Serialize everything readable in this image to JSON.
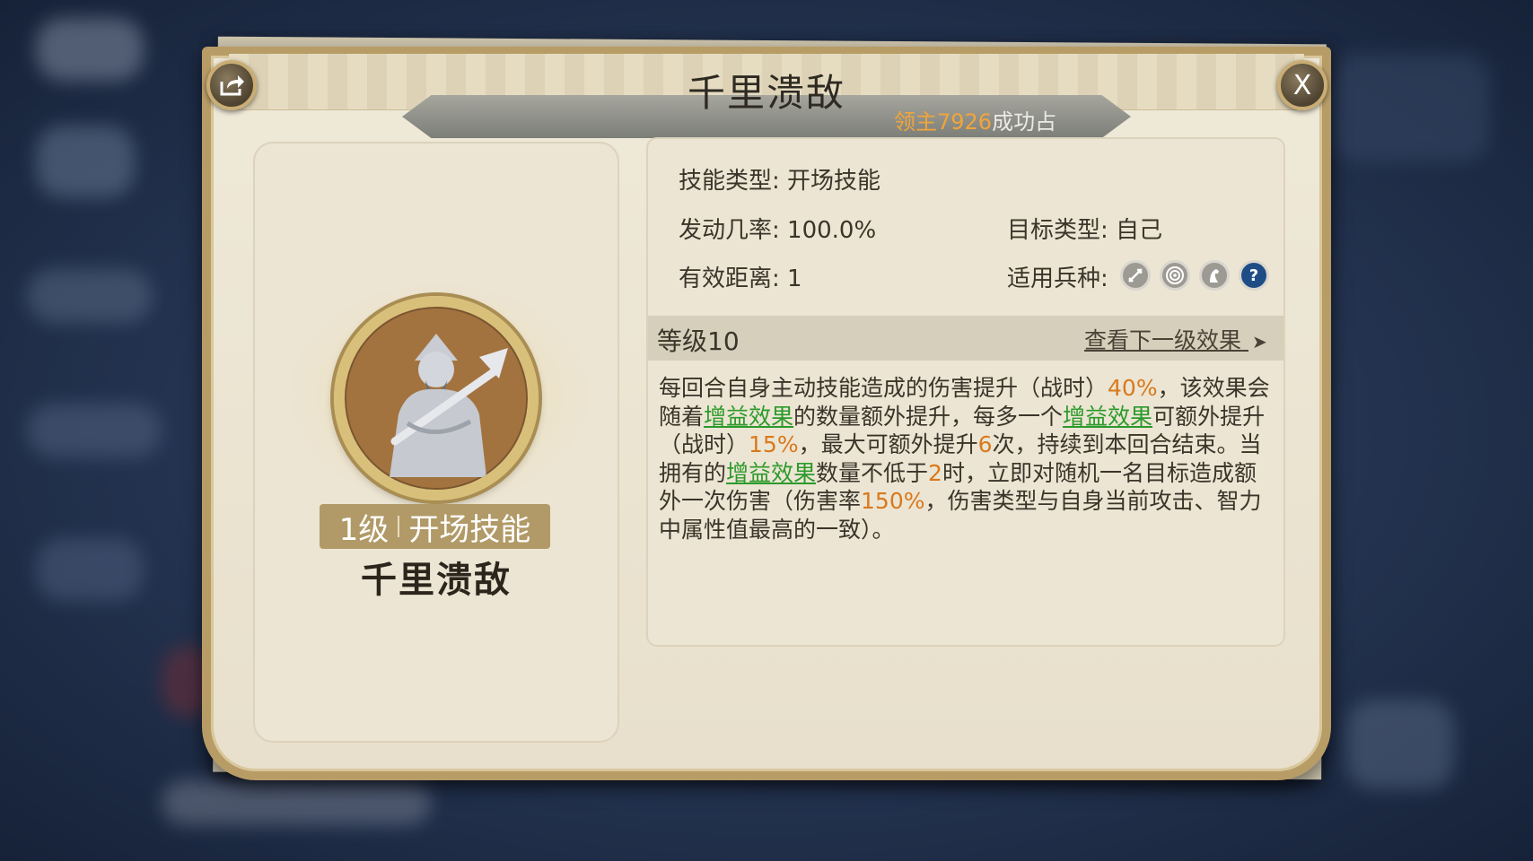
{
  "dialog": {
    "title": "千里溃敌",
    "subtitle_owner": "领主7926",
    "subtitle_rest": "成功占",
    "close_label": "X"
  },
  "skill_card": {
    "level_text": "1级",
    "type_text": "开场技能",
    "name": "千里溃敌"
  },
  "info": {
    "skill_type_label": "技能类型:",
    "skill_type_value": "开场技能",
    "trigger_rate_label": "发动几率:",
    "trigger_rate_value": "100.0%",
    "target_type_label": "目标类型:",
    "target_type_value": "自己",
    "range_label": "有效距离:",
    "range_value": "1",
    "troop_label": "适用兵种:",
    "troop_icons": [
      "sword-icon",
      "target-icon",
      "horse-icon",
      "help-icon"
    ],
    "help_glyph": "?"
  },
  "level": {
    "label": "等级10",
    "next_link": "查看下一级效果",
    "arrow": "➤"
  },
  "description": {
    "p1": "每回合自身主动技能造成的伤害提升（战时）",
    "v1": "40%",
    "p2": "，该效果会随着",
    "k1": "增益效果",
    "p3": "的数量额外提升，每多一个",
    "k2": "增益效果",
    "p4": "可额外提升（战时）",
    "v2": "15%",
    "p5": "，最大可额外提升",
    "v3": "6",
    "p6": "次，持续到本回合结束。当拥有的",
    "k3": "增益效果",
    "p7": "数量不低于",
    "v4": "2",
    "p8": "时，立即对随机一名目标造成额外一次伤害（伤害率",
    "v5": "150%",
    "p9": "，伤害类型与自身当前攻击、智力中属性值最高的一致）。"
  },
  "colors": {
    "highlight_orange": "#d9791d",
    "highlight_green": "#2b9a2b",
    "frame_gold": "#b89c66"
  }
}
